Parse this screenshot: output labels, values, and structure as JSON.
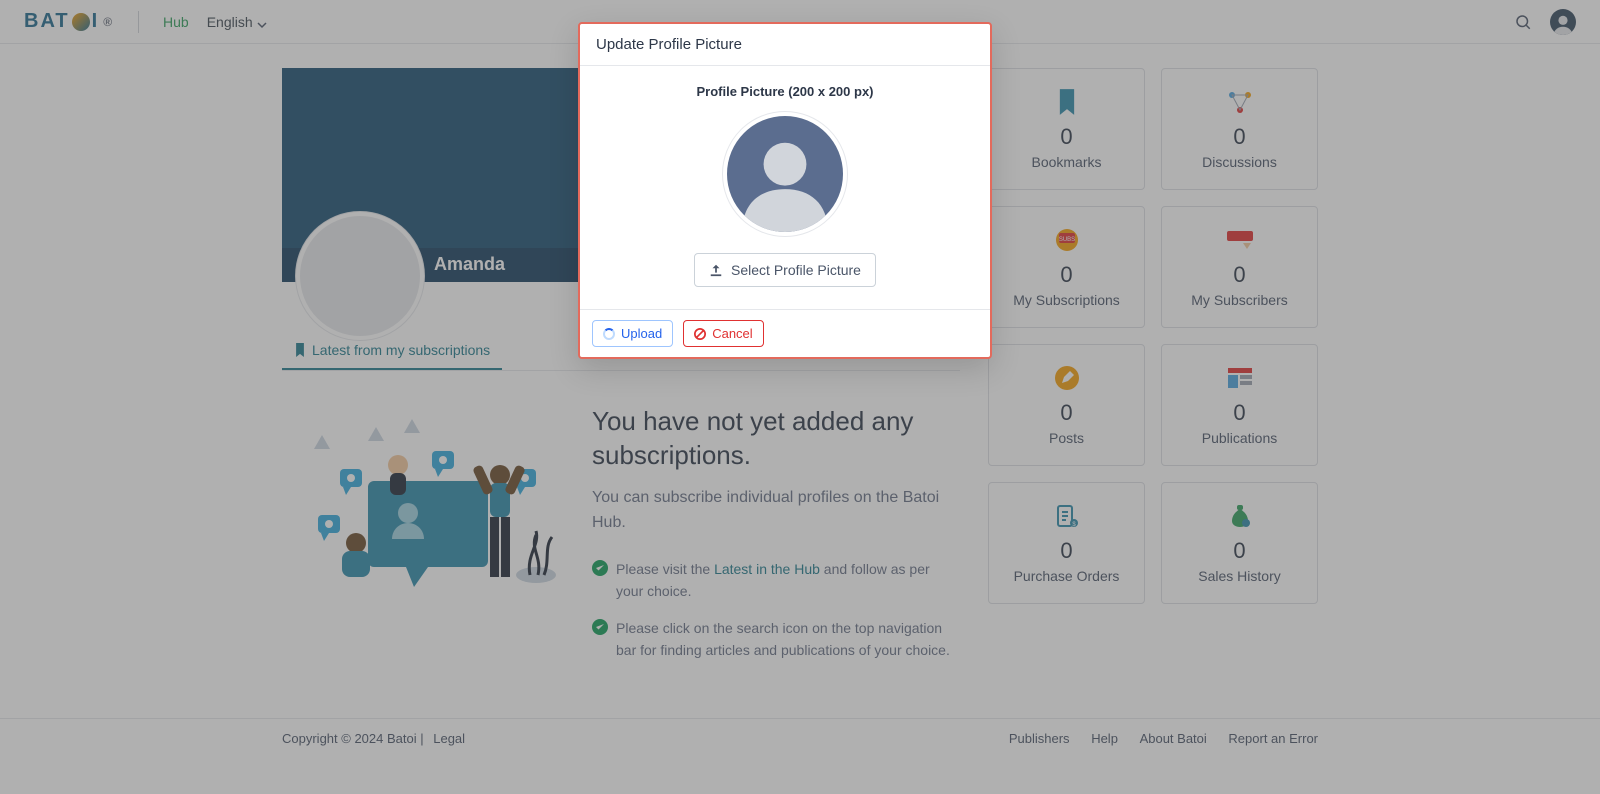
{
  "nav": {
    "logo_text": "BATOI",
    "hub_label": "Hub",
    "language_label": "English"
  },
  "profile": {
    "name": "Amanda"
  },
  "tabs": {
    "latest_label": "Latest from my subscriptions"
  },
  "empty": {
    "heading": "You have not yet added any subscriptions.",
    "sub": "You can subscribe individual profiles on the Batoi Hub.",
    "tip1_pre": "Please visit the ",
    "tip1_link": "Latest in the Hub",
    "tip1_post": " and follow as per your choice.",
    "tip2": "Please click on the search icon on the top navigation bar for finding articles and publications of your choice."
  },
  "stats": {
    "bookmarks": {
      "count": "0",
      "label": "Bookmarks"
    },
    "discussions": {
      "count": "0",
      "label": "Discussions"
    },
    "my_subscriptions": {
      "count": "0",
      "label": "My Subscriptions"
    },
    "my_subscribers": {
      "count": "0",
      "label": "My Subscribers"
    },
    "posts": {
      "count": "0",
      "label": "Posts"
    },
    "publications": {
      "count": "0",
      "label": "Publications"
    },
    "purchase_orders": {
      "count": "0",
      "label": "Purchase Orders"
    },
    "sales_history": {
      "count": "0",
      "label": "Sales History"
    }
  },
  "modal": {
    "title": "Update Profile Picture",
    "pp_label": "Profile Picture (200 x 200 px)",
    "select_label": "Select Profile Picture",
    "upload_label": "Upload",
    "cancel_label": "Cancel"
  },
  "footer": {
    "copyright": "Copyright © 2024 Batoi",
    "sep": " | ",
    "legal": "Legal",
    "links": [
      "Publishers",
      "Help",
      "About Batoi",
      "Report an Error"
    ]
  }
}
